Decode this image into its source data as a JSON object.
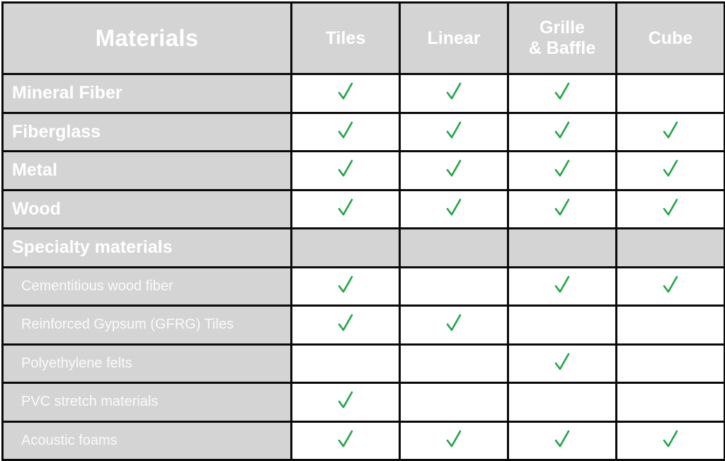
{
  "table": {
    "header": {
      "title": "Materials",
      "columns": [
        "Tiles",
        "Linear",
        "Grille\n& Baffle",
        "Cube"
      ],
      "columns_lines": [
        [
          "Tiles"
        ],
        [
          "Linear"
        ],
        [
          "Grille",
          "& Baffle"
        ],
        [
          "Cube"
        ]
      ]
    },
    "check_icon": "check-mark-icon",
    "check_color": "#22a447",
    "rows": [
      {
        "label": "Mineral Fiber",
        "style": "main",
        "checks": [
          true,
          true,
          true,
          false
        ]
      },
      {
        "label": "Fiberglass",
        "style": "main",
        "checks": [
          true,
          true,
          true,
          true
        ]
      },
      {
        "label": "Metal",
        "style": "main",
        "checks": [
          true,
          true,
          true,
          true
        ]
      },
      {
        "label": "Wood",
        "style": "main",
        "checks": [
          true,
          true,
          true,
          true
        ]
      },
      {
        "label": "Specialty materials",
        "style": "section",
        "checks": [
          false,
          false,
          false,
          false
        ]
      },
      {
        "label": "Cementitious wood fiber",
        "style": "sub",
        "checks": [
          true,
          false,
          true,
          true
        ]
      },
      {
        "label": "Reinforced Gypsum (GFRG) Tiles",
        "style": "sub",
        "checks": [
          true,
          true,
          false,
          false
        ]
      },
      {
        "label": "Polyethylene felts",
        "style": "sub",
        "checks": [
          false,
          false,
          true,
          false
        ]
      },
      {
        "label": "PVC stretch materials",
        "style": "sub",
        "checks": [
          true,
          false,
          false,
          false
        ]
      },
      {
        "label": "Acoustic foams",
        "style": "sub",
        "checks": [
          true,
          true,
          true,
          true
        ]
      }
    ]
  }
}
